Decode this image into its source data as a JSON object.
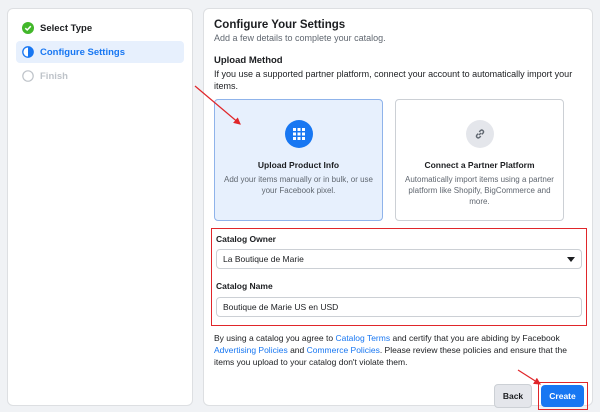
{
  "sidebar": {
    "steps": [
      {
        "label": "Select Type",
        "state": "done"
      },
      {
        "label": "Configure Settings",
        "state": "active"
      },
      {
        "label": "Finish",
        "state": "pending"
      }
    ]
  },
  "main": {
    "title": "Configure Your Settings",
    "subtitle": "Add a few details to complete your catalog.",
    "upload_method": {
      "title": "Upload Method",
      "description": "If you use a supported partner platform, connect your account to automatically import your items.",
      "options": [
        {
          "title": "Upload Product Info",
          "description": "Add your items manually or in bulk, or use your Facebook pixel.",
          "icon": "grid-icon",
          "selected": true
        },
        {
          "title": "Connect a Partner Platform",
          "description": "Automatically import items using a partner platform like Shopify, BigCommerce and more.",
          "icon": "link-icon",
          "selected": false
        }
      ]
    },
    "catalog_owner": {
      "label": "Catalog Owner",
      "value": "La Boutique de Marie"
    },
    "catalog_name": {
      "label": "Catalog Name",
      "value": "Boutique de Marie US en USD"
    },
    "legal": {
      "t1": "By using a catalog you agree to ",
      "link1": "Catalog Terms",
      "t2": " and certify that you are abiding by Facebook ",
      "link2": "Advertising Policies",
      "t3": " and ",
      "link3": "Commerce Policies",
      "t4": ". Please review these policies and ensure that the items you upload to your catalog don't violate them."
    },
    "buttons": {
      "back": "Back",
      "create": "Create"
    }
  },
  "colors": {
    "accent": "#1877f2",
    "annotation": "#e0262a",
    "done": "#42b72a"
  }
}
